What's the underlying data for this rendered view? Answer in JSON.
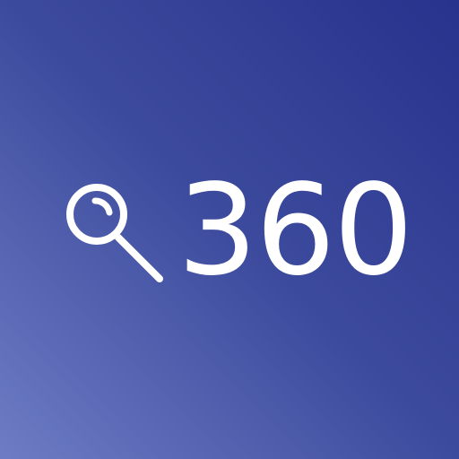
{
  "app": {
    "wordmark": "360",
    "icon": "magnifier-icon"
  },
  "colors": {
    "background_top_right": "#27338c",
    "background_bottom_left": "#6d7cc4",
    "foreground": "#ffffff"
  }
}
